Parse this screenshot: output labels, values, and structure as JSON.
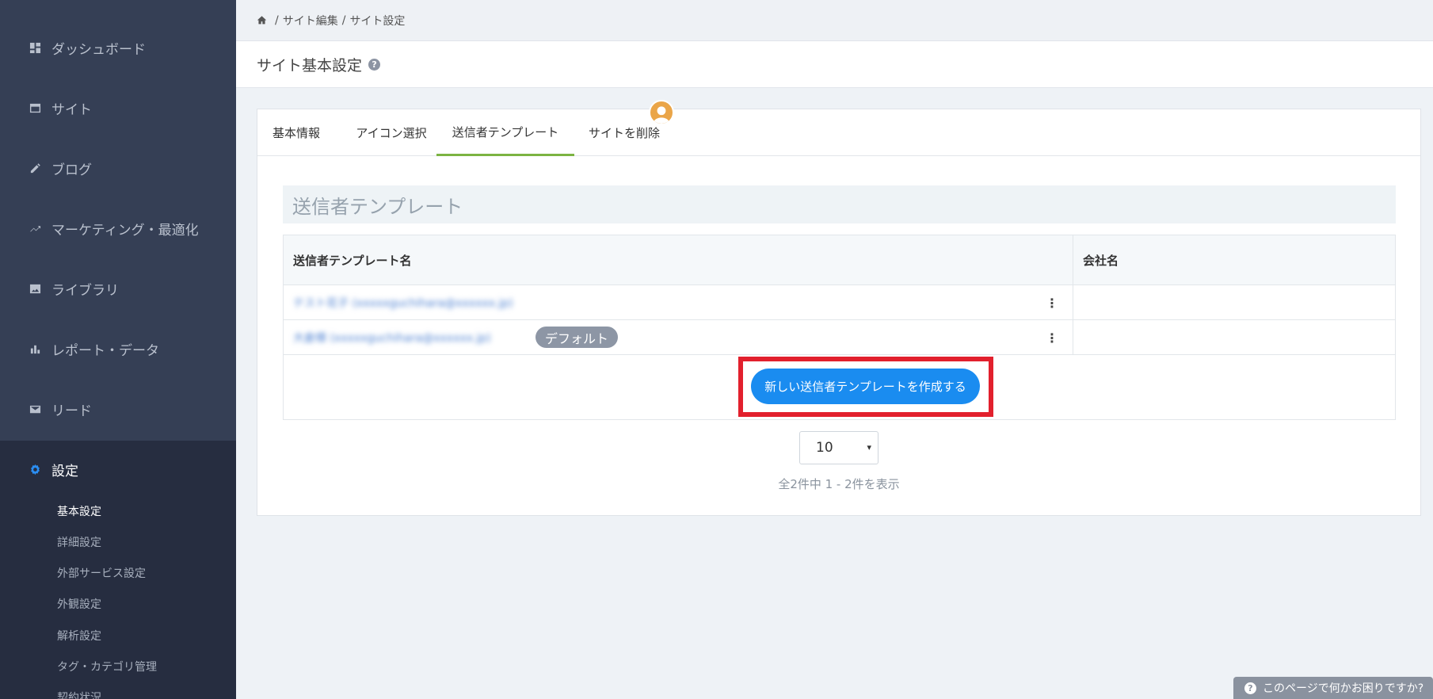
{
  "sidebar": {
    "items": [
      {
        "label": "ダッシュボード",
        "icon": "dashboard-icon"
      },
      {
        "label": "サイト",
        "icon": "browser-window-icon"
      },
      {
        "label": "ブログ",
        "icon": "pencil-icon"
      },
      {
        "label": "マーケティング・最適化",
        "icon": "trending-up-icon"
      },
      {
        "label": "ライブラリ",
        "icon": "image-icon"
      },
      {
        "label": "レポート・データ",
        "icon": "bar-chart-icon"
      },
      {
        "label": "リード",
        "icon": "envelope-icon"
      },
      {
        "label": "設定",
        "icon": "gear-icon"
      }
    ],
    "sub_items": [
      "基本設定",
      "詳細設定",
      "外部サービス設定",
      "外観設定",
      "解析設定",
      "タグ・カテゴリ管理",
      "契約状況"
    ]
  },
  "breadcrumb": {
    "items": [
      "サイト編集",
      "サイト設定"
    ]
  },
  "page": {
    "title": "サイト基本設定",
    "help_glyph": "?"
  },
  "tabs": [
    "基本情報",
    "アイコン選択",
    "送信者テンプレート",
    "サイトを削除"
  ],
  "section": {
    "title": "送信者テンプレート"
  },
  "table": {
    "headers": [
      "送信者テンプレート名",
      "会社名"
    ],
    "rows": [
      {
        "name": "テスト花子 (xxxxxguchihara@xxxxxx.jp)",
        "company": "",
        "default": false
      },
      {
        "name": "大倉様 (xxxxxguchihara@xxxxxx.jp)",
        "company": "",
        "default": true
      }
    ],
    "default_badge": "デフォルト",
    "kebab_glyph": "⋮"
  },
  "create_button": {
    "label": "新しい送信者テンプレートを作成する"
  },
  "pagination": {
    "per_page": "10",
    "caret": "▾",
    "count_text": "全2件中 1 - 2件を表示"
  },
  "help_widget": {
    "label": "このページで何かお困りですか?",
    "glyph": "?"
  },
  "colors": {
    "sidebar": "#353f55",
    "sidebar_active": "#262d40",
    "accent_tab": "#7cb342",
    "primary": "#1a8cf0",
    "highlight": "#e2202d"
  }
}
